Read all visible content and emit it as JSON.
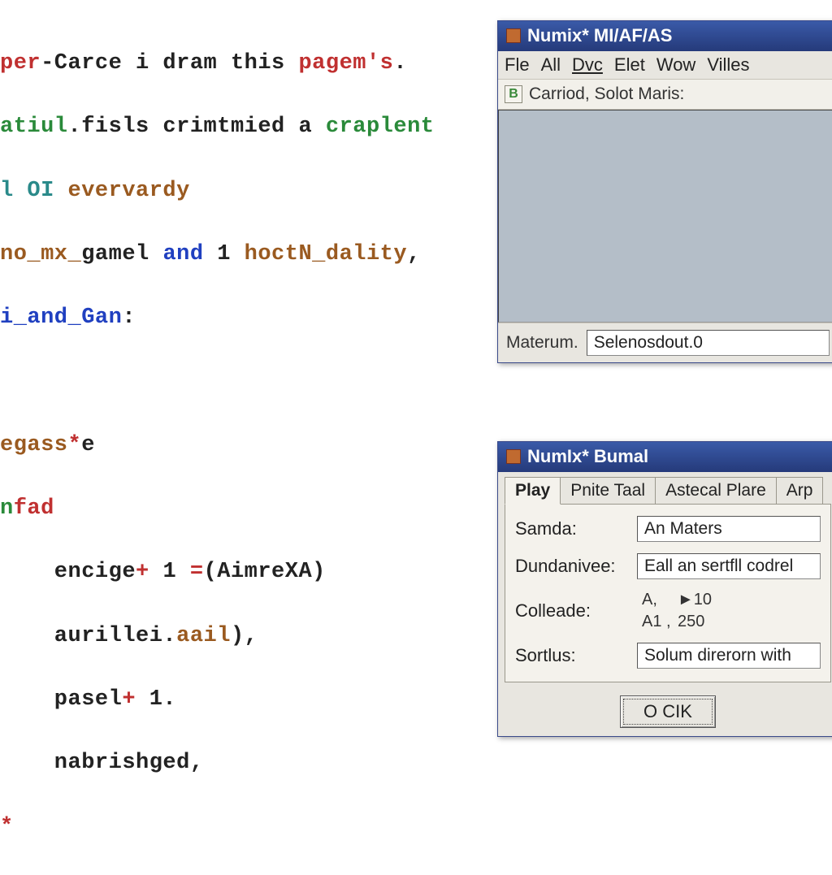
{
  "code": {
    "l1a": "per",
    "l1b": "-Carce i dram this ",
    "l1c": "pagem's",
    "l1d": ".",
    "l2a": "atiul",
    "l2b": ".fisls crimtmied a ",
    "l2c": "craplent",
    "l3a": "l OI ",
    "l3b": "evervardy",
    "l4a": "no_mx_",
    "l4b": "gamel ",
    "l4c": "and",
    "l4d": " 1 ",
    "l4e": "hoctN_dality",
    "l4f": ",",
    "l5a": "i_and_Gan",
    "l5b": ":",
    "l7a": "egass",
    "l7b": "*",
    "l7c": "e",
    "l8a": "n",
    "l8b": "fad",
    "l9a": "    encige",
    "l9b": "+ ",
    "l9c": "1 ",
    "l9d": "=",
    "l9e": "(AimreXA)",
    "l10a": "    aurillei.",
    "l10b": "aail",
    "l10c": "),",
    "l11a": "    pasel",
    "l11b": "+ ",
    "l11c": "1.",
    "l12": "    nabrishged,",
    "l13": "*"
  },
  "win1": {
    "title": "Numix* MI/AF/AS",
    "menu": {
      "fle": "Fle",
      "all": "All",
      "dvc": "Dvc",
      "elet": "Elet",
      "wow": "Wow",
      "villes": "Villes"
    },
    "toolbar": {
      "btn": "B",
      "text": "Carriod, Solot Maris:"
    },
    "status": {
      "label": "Materum.",
      "value": "Selenosdout.0"
    }
  },
  "win2": {
    "title": "NumIx* Bumal",
    "tabs": {
      "play": "Play",
      "pnite": "Pnite Taal",
      "astecal": "Astecal Plare",
      "arp": "Arp"
    },
    "form": {
      "samda_label": "Samda:",
      "samda_value": "An Maters",
      "dundanivee_label": "Dundanivee:",
      "dundanivee_value": "Eall an sertfll codrel",
      "colleade_label": "Colleade:",
      "col_a1": "A,",
      "col_a1v": "►10",
      "col_a2": "A1 ,",
      "col_a2v": "250",
      "sortlus_label": "Sortlus:",
      "sortlus_value": "Solum direrorn with"
    },
    "ok": "O CIK"
  }
}
